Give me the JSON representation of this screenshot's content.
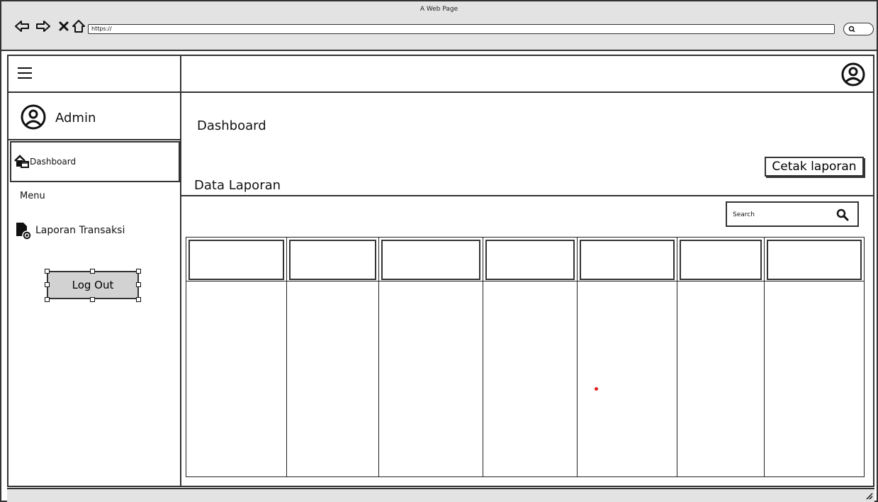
{
  "browser": {
    "window_title": "A Web Page",
    "url": "https://"
  },
  "sidebar": {
    "user_label": "Admin",
    "nav_active_label": "Dashboard",
    "menu_heading": "Menu",
    "menu_items": [
      {
        "label": "Laporan Transaksi",
        "icon": "report-file-icon"
      }
    ],
    "logout_label": "Log Out"
  },
  "main": {
    "page_title": "Dashboard",
    "print_button_label": "Cetak laporan",
    "section_title": "Data Laporan",
    "search_placeholder": "Search"
  },
  "table": {
    "columns": [
      "",
      "",
      "",
      "",
      "",
      "",
      ""
    ]
  },
  "colors": {
    "chrome_bg": "#e3e3e3",
    "button_gray": "#d2d2d2",
    "stroke": "#333333",
    "marker_red": "#e02020"
  }
}
